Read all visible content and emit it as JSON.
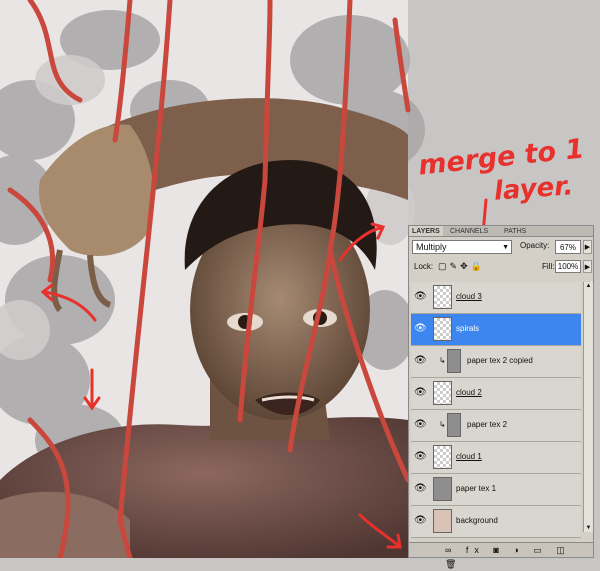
{
  "panel": {
    "tabs": [
      "LAYERS",
      "CHANNELS",
      "PATHS"
    ],
    "blend_mode": "Multiply",
    "opacity_label": "Opacity:",
    "opacity_value": "67%",
    "lock_label": "Lock:",
    "fill_label": "Fill:",
    "fill_value": "100%",
    "bottom_icons": "∞ fx ◙ ◑ ▭ ◫ 🗑"
  },
  "layers": [
    {
      "name": "cloud 3",
      "thumb": "checker",
      "selected": false,
      "clipped": false,
      "underline": true
    },
    {
      "name": "spirals",
      "thumb": "checker",
      "selected": true,
      "clipped": false,
      "underline": false
    },
    {
      "name": "paper tex 2 copied",
      "thumb": "gray",
      "selected": false,
      "clipped": true,
      "underline": false
    },
    {
      "name": "cloud 2",
      "thumb": "checker",
      "selected": false,
      "clipped": false,
      "underline": true
    },
    {
      "name": "paper tex 2",
      "thumb": "gray",
      "selected": false,
      "clipped": true,
      "underline": false
    },
    {
      "name": "cloud 1",
      "thumb": "checker",
      "selected": false,
      "clipped": false,
      "underline": true
    },
    {
      "name": "paper tex 1",
      "thumb": "gray",
      "selected": false,
      "clipped": false,
      "underline": false
    },
    {
      "name": "background",
      "thumb": "beige",
      "selected": false,
      "clipped": false,
      "underline": false
    }
  ],
  "annotation": {
    "line1": "merge to 1",
    "line2": "layer.",
    "color": "#e8312d"
  }
}
